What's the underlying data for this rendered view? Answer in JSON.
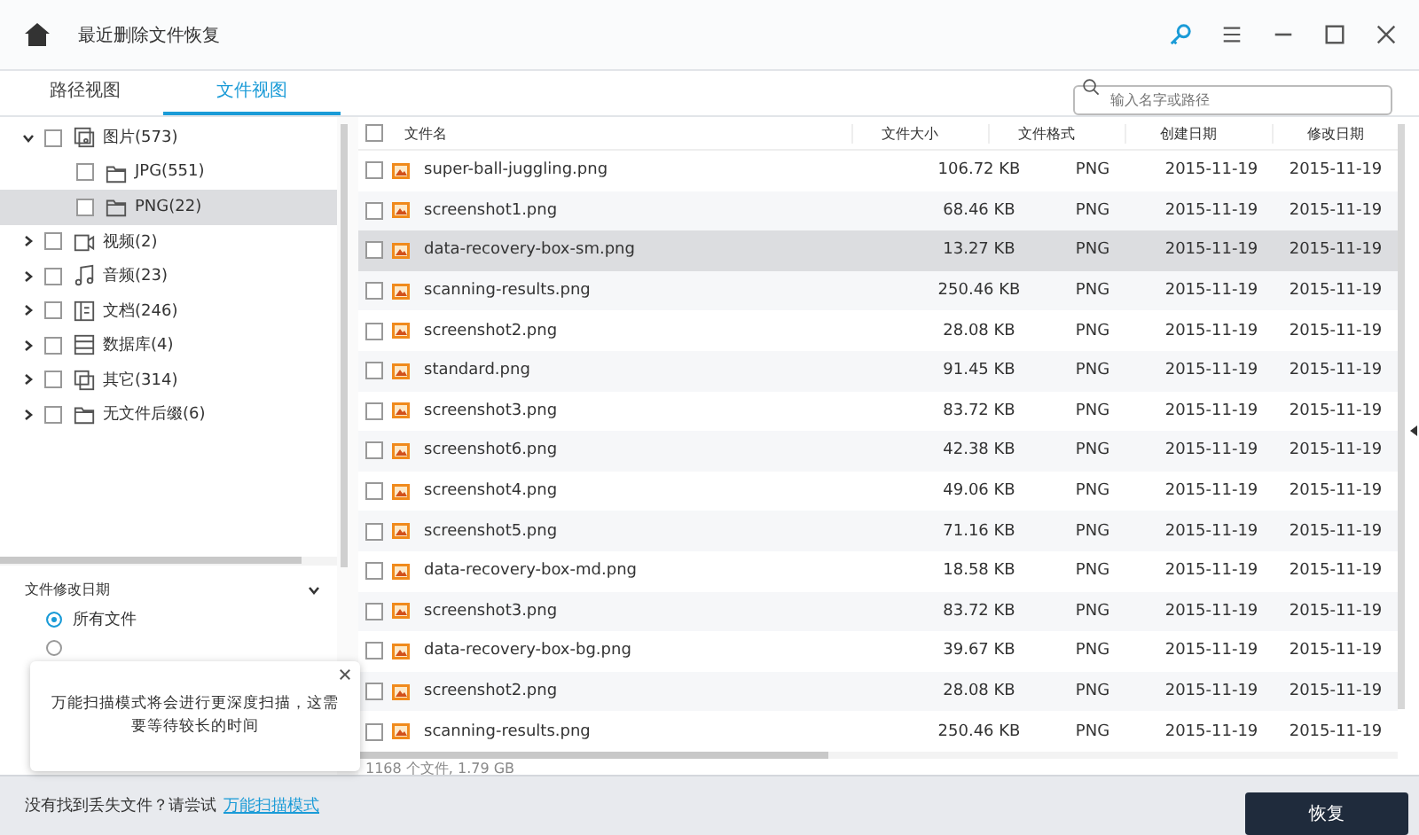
{
  "window": {
    "title": "最近删除文件恢复"
  },
  "tabs": [
    {
      "label": "路径视图",
      "selected": false
    },
    {
      "label": "文件视图",
      "selected": true
    }
  ],
  "search": {
    "placeholder": "输入名字或路径"
  },
  "tree": [
    {
      "label": "图片(573)",
      "kind": "image",
      "checked": false,
      "expanded": true,
      "selected": false,
      "children": [
        {
          "label": "JPG(551)",
          "checked": false,
          "selected": false
        },
        {
          "label": "PNG(22)",
          "checked": false,
          "selected": true
        }
      ]
    },
    {
      "label": "视频(2)",
      "kind": "video",
      "checked": false,
      "expanded": false,
      "selected": false
    },
    {
      "label": "音频(23)",
      "kind": "audio",
      "checked": false,
      "expanded": false,
      "selected": false
    },
    {
      "label": "文档(246)",
      "kind": "doc",
      "checked": false,
      "expanded": false,
      "selected": false
    },
    {
      "label": "数据库(4)",
      "kind": "db",
      "checked": false,
      "expanded": false,
      "selected": false
    },
    {
      "label": "其它(314)",
      "kind": "other",
      "checked": false,
      "expanded": false,
      "selected": false
    },
    {
      "label": "无文件后缀(6)",
      "kind": "folder",
      "checked": false,
      "expanded": false,
      "selected": false
    }
  ],
  "filter": {
    "title": "文件修改日期",
    "options": [
      {
        "label": "所有文件",
        "selected": true
      }
    ],
    "hidden_option": {
      "selected": false
    }
  },
  "popup": {
    "text": "万能扫描模式将会进行更深度扫描，这需要等待较长的时间"
  },
  "table": {
    "all_checked": false,
    "columns": [
      "文件名",
      "文件大小",
      "文件格式",
      "创建日期",
      "修改日期"
    ],
    "rows": [
      {
        "name": "super-ball-juggling.png",
        "size": "106.72 KB",
        "format": "PNG",
        "created": "2015-11-19",
        "modified": "2015-11-19",
        "selected": false,
        "checked": false
      },
      {
        "name": "screenshot1.png",
        "size": "68.46 KB",
        "format": "PNG",
        "created": "2015-11-19",
        "modified": "2015-11-19",
        "selected": false,
        "checked": false
      },
      {
        "name": "data-recovery-box-sm.png",
        "size": "13.27 KB",
        "format": "PNG",
        "created": "2015-11-19",
        "modified": "2015-11-19",
        "selected": true,
        "checked": false
      },
      {
        "name": "scanning-results.png",
        "size": "250.46 KB",
        "format": "PNG",
        "created": "2015-11-19",
        "modified": "2015-11-19",
        "selected": false,
        "checked": false
      },
      {
        "name": "screenshot2.png",
        "size": "28.08 KB",
        "format": "PNG",
        "created": "2015-11-19",
        "modified": "2015-11-19",
        "selected": false,
        "checked": false
      },
      {
        "name": "standard.png",
        "size": "91.45 KB",
        "format": "PNG",
        "created": "2015-11-19",
        "modified": "2015-11-19",
        "selected": false,
        "checked": false
      },
      {
        "name": "screenshot3.png",
        "size": "83.72 KB",
        "format": "PNG",
        "created": "2015-11-19",
        "modified": "2015-11-19",
        "selected": false,
        "checked": false
      },
      {
        "name": "screenshot6.png",
        "size": "42.38 KB",
        "format": "PNG",
        "created": "2015-11-19",
        "modified": "2015-11-19",
        "selected": false,
        "checked": false
      },
      {
        "name": "screenshot4.png",
        "size": "49.06 KB",
        "format": "PNG",
        "created": "2015-11-19",
        "modified": "2015-11-19",
        "selected": false,
        "checked": false
      },
      {
        "name": "screenshot5.png",
        "size": "71.16 KB",
        "format": "PNG",
        "created": "2015-11-19",
        "modified": "2015-11-19",
        "selected": false,
        "checked": false
      },
      {
        "name": "data-recovery-box-md.png",
        "size": "18.58 KB",
        "format": "PNG",
        "created": "2015-11-19",
        "modified": "2015-11-19",
        "selected": false,
        "checked": false
      },
      {
        "name": "screenshot3.png",
        "size": "83.72 KB",
        "format": "PNG",
        "created": "2015-11-19",
        "modified": "2015-11-19",
        "selected": false,
        "checked": false
      },
      {
        "name": "data-recovery-box-bg.png",
        "size": "39.67 KB",
        "format": "PNG",
        "created": "2015-11-19",
        "modified": "2015-11-19",
        "selected": false,
        "checked": false
      },
      {
        "name": "screenshot2.png",
        "size": "28.08 KB",
        "format": "PNG",
        "created": "2015-11-19",
        "modified": "2015-11-19",
        "selected": false,
        "checked": false
      },
      {
        "name": "scanning-results.png",
        "size": "250.46 KB",
        "format": "PNG",
        "created": "2015-11-19",
        "modified": "2015-11-19",
        "selected": false,
        "checked": false
      }
    ]
  },
  "summary": "1168 个文件, 1.79 GB",
  "footer": {
    "prompt": "没有找到丢失文件？请尝试",
    "link": "万能扫描模式",
    "button": "恢复"
  }
}
